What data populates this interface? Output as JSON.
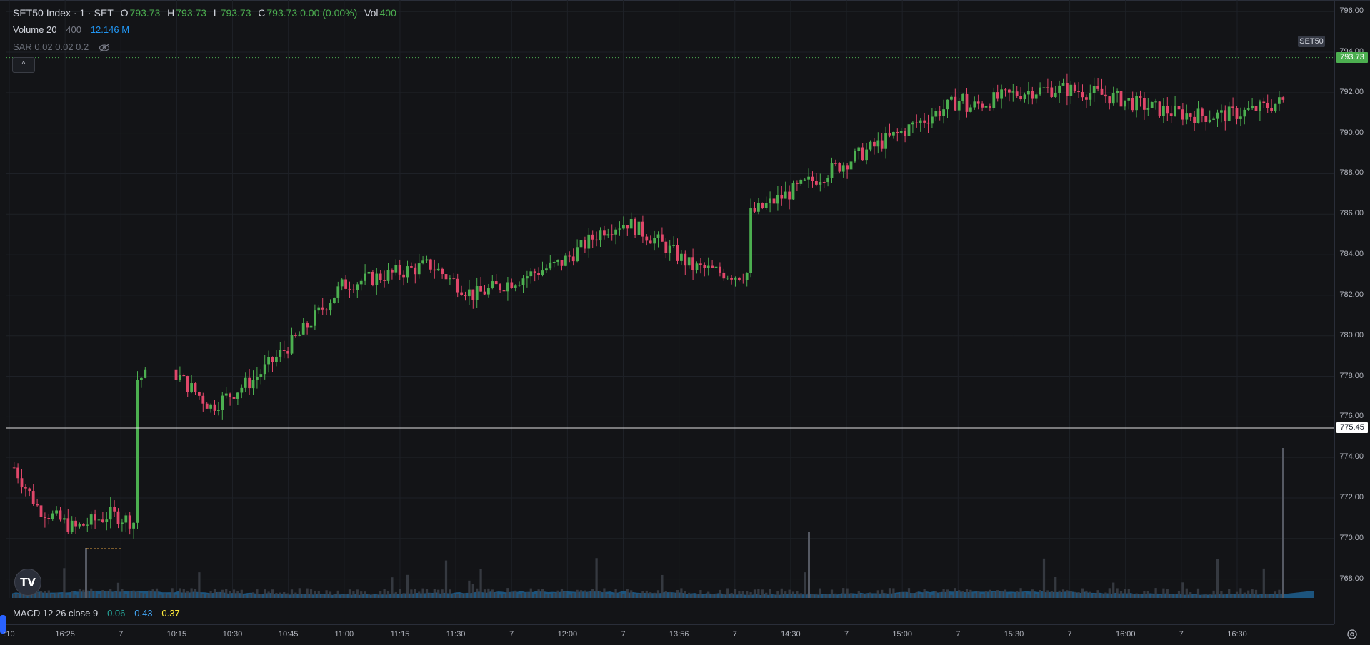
{
  "legend": {
    "symbol": "SET50 Index · 1 · SET",
    "o_label": "O",
    "o_value": "793.73",
    "h_label": "H",
    "h_value": "793.73",
    "l_label": "L",
    "l_value": "793.73",
    "c_label": "C",
    "c_value": "793.73 0.00 (0.00%)",
    "vol_label": "Vol",
    "vol_value": "400"
  },
  "volume_legend": {
    "name": "Volume 20",
    "value1": "400",
    "value2": "12.146 M"
  },
  "sar_legend": {
    "text": "SAR 0.02 0.02 0.2"
  },
  "macd_legend": {
    "name": "MACD 12 26 close 9",
    "v1": "0.06",
    "v2": "0.43",
    "v3": "0.37"
  },
  "collapse_button": "^",
  "set50_tag": "SET50",
  "last_price_tag": "793.73",
  "crosshair_price_tag": "775.45",
  "logo_text": "TV",
  "price_axis": [
    "796.00",
    "794.00",
    "792.00",
    "790.00",
    "788.00",
    "786.00",
    "784.00",
    "782.00",
    "780.00",
    "778.00",
    "776.00",
    "774.00",
    "772.00",
    "770.00",
    "768.00"
  ],
  "time_axis": [
    ":10",
    "16:25",
    "7",
    "10:15",
    "10:30",
    "10:45",
    "11:00",
    "11:15",
    "11:30",
    "7",
    "12:00",
    "7",
    "13:56",
    "7",
    "14:30",
    "7",
    "15:00",
    "7",
    "15:30",
    "7",
    "16:00",
    "7",
    "16:30"
  ],
  "colors": {
    "up": "#4caf50",
    "down": "#e0476a",
    "background": "#131417",
    "grid": "#1e2127",
    "volume": "#1f5f8f",
    "volume_bar": "#3a3d45",
    "macd": "#42a5f5",
    "signal": "#ffeb3b"
  },
  "chart_data": {
    "type": "candlestick",
    "symbol": "SET50 Index",
    "interval": "1",
    "y_range": [
      767,
      796.5
    ],
    "price_path": [
      [
        0.0,
        773.5
      ],
      [
        0.02,
        771.5
      ],
      [
        0.05,
        770.5
      ],
      [
        0.08,
        771.2
      ],
      [
        0.1,
        770.8
      ],
      [
        0.15,
        777.8
      ],
      [
        0.18,
        778.5
      ],
      [
        0.22,
        776.5
      ],
      [
        0.26,
        777.9
      ],
      [
        0.3,
        780.0
      ],
      [
        0.34,
        782.5
      ],
      [
        0.38,
        783.0
      ],
      [
        0.42,
        783.5
      ],
      [
        0.46,
        782.0
      ],
      [
        0.5,
        782.8
      ],
      [
        0.54,
        783.6
      ],
      [
        0.58,
        785.3
      ],
      [
        0.6,
        785.6
      ],
      [
        0.63,
        784.6
      ],
      [
        0.66,
        783.4
      ],
      [
        0.7,
        783.0
      ],
      [
        0.74,
        783.4
      ],
      [
        0.78,
        783.6
      ],
      [
        0.82,
        784.3
      ],
      [
        0.86,
        784.2
      ],
      [
        0.88,
        783.2
      ],
      [
        0.9,
        782.6
      ],
      [
        0.92,
        785.0
      ],
      [
        0.95,
        787.5
      ],
      [
        0.97,
        789.5
      ]
    ],
    "last_price": 793.73,
    "crosshair_price": 775.45
  }
}
